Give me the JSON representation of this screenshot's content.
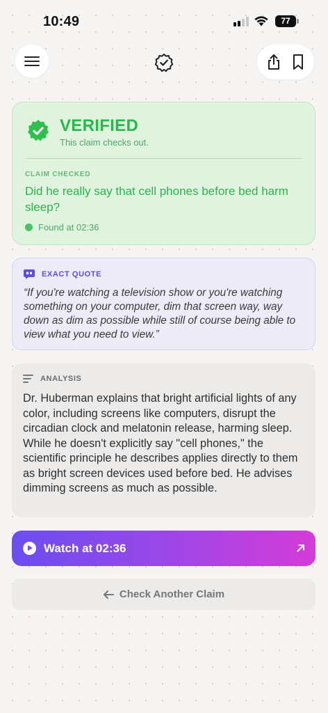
{
  "status_bar": {
    "time": "10:49",
    "battery": "77"
  },
  "header": {
    "menu_icon": "hamburger-icon",
    "center_icon": "verified-badge-icon",
    "share_icon": "share-icon",
    "bookmark_icon": "bookmark-icon"
  },
  "verdict": {
    "title": "VERIFIED",
    "subtitle": "This claim checks out.",
    "claim_label": "CLAIM CHECKED",
    "claim": "Did he really say that cell phones before bed harm sleep?",
    "found_at": "Found at 02:36",
    "color": "#28b84b"
  },
  "quote": {
    "label": "EXACT QUOTE",
    "text": "“If you're watching a television show or you're watching something on your computer, dim that screen way, way down as dim as possible while still of course being able to view what you need to view.”",
    "color": "#5b4de0"
  },
  "analysis": {
    "label": "ANALYSIS",
    "text": "Dr. Huberman explains that bright artificial lights of any color, including screens like computers, disrupt the circadian clock and melatonin release, harming sleep. While he doesn't explicitly say \"cell phones,\" the scientific principle he describes applies directly to them as bright screen devices used before bed. He advises dimming screens as much as possible."
  },
  "actions": {
    "watch_label": "Watch at 02:36",
    "check_another_label": "Check Another Claim"
  }
}
